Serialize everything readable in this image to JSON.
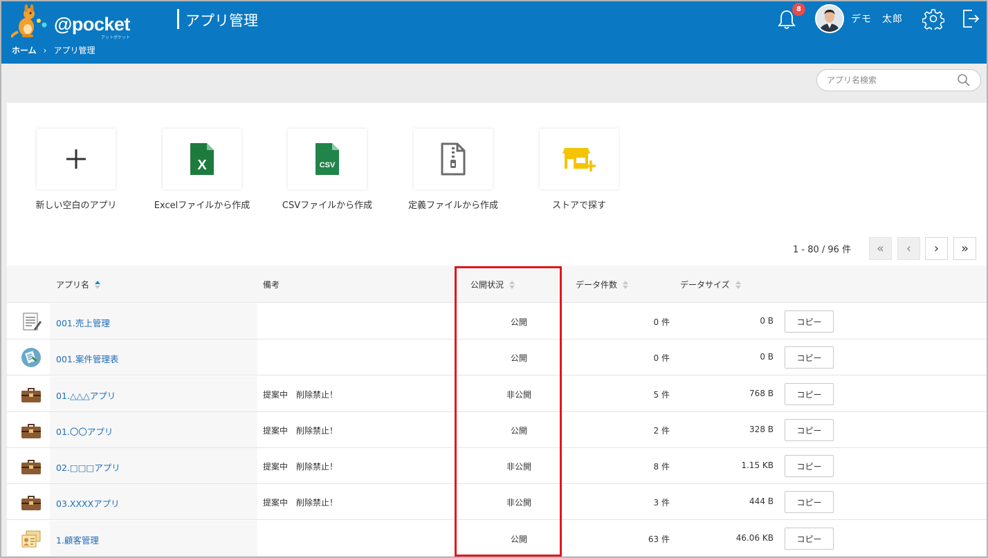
{
  "header": {
    "logo_text": "@pocket",
    "logo_sub": "アットポケット",
    "page_title": "アプリ管理",
    "notification_count": "8",
    "user_name": "デモ　太郎"
  },
  "breadcrumb": {
    "home": "ホーム",
    "separator": "›",
    "current": "アプリ管理"
  },
  "search": {
    "placeholder": "アプリ名検索"
  },
  "create_options": [
    {
      "label": "新しい空白のアプリ",
      "icon": "plus-icon"
    },
    {
      "label": "Excelファイルから作成",
      "icon": "excel-file-icon",
      "icon_text": "X"
    },
    {
      "label": "CSVファイルから作成",
      "icon": "csv-file-icon",
      "icon_text": "CSV"
    },
    {
      "label": "定義ファイルから作成",
      "icon": "zip-file-icon"
    },
    {
      "label": "ストアで探す",
      "icon": "store-icon"
    }
  ],
  "pagination": {
    "range": "1 - 80 / 96 件",
    "first": "«",
    "prev": "‹",
    "next": "›",
    "last": "»"
  },
  "table": {
    "columns": {
      "name": "アプリ名",
      "note": "備考",
      "status": "公開状況",
      "count": "データ件数",
      "size": "データサイズ"
    },
    "copy_label": "コピー",
    "rows": [
      {
        "icon": "notepad-icon",
        "name": "001.売上管理",
        "note": "",
        "status": "公開",
        "count": "0 件",
        "size": "0 B"
      },
      {
        "icon": "circle-doc-icon",
        "name": "001.案件管理表",
        "note": "",
        "status": "公開",
        "count": "0 件",
        "size": "0 B"
      },
      {
        "icon": "briefcase-icon",
        "name": "01.△△△アプリ",
        "note": "提案中　削除禁止！",
        "status": "非公開",
        "count": "5 件",
        "size": "768 B"
      },
      {
        "icon": "briefcase-icon",
        "name": "01.〇〇アプリ",
        "note": "提案中　削除禁止！",
        "status": "公開",
        "count": "2 件",
        "size": "328 B"
      },
      {
        "icon": "briefcase-icon",
        "name": "02.□□□アプリ",
        "note": "提案中　削除禁止！",
        "status": "非公開",
        "count": "8 件",
        "size": "1.15 KB"
      },
      {
        "icon": "briefcase-icon",
        "name": "03.XXXXアプリ",
        "note": "提案中　削除禁止！",
        "status": "非公開",
        "count": "3 件",
        "size": "444 B"
      },
      {
        "icon": "contact-card-icon",
        "name": "1.顧客管理",
        "note": "",
        "status": "公開",
        "count": "63 件",
        "size": "46.06 KB"
      }
    ]
  },
  "colors": {
    "header_bg": "#0a78c2",
    "link": "#1e6bb8",
    "highlight": "#e3151c",
    "badge": "#e94b4b",
    "excel_green": "#1e7b3e",
    "csv_green": "#21844a",
    "store_yellow": "#f5c400"
  }
}
